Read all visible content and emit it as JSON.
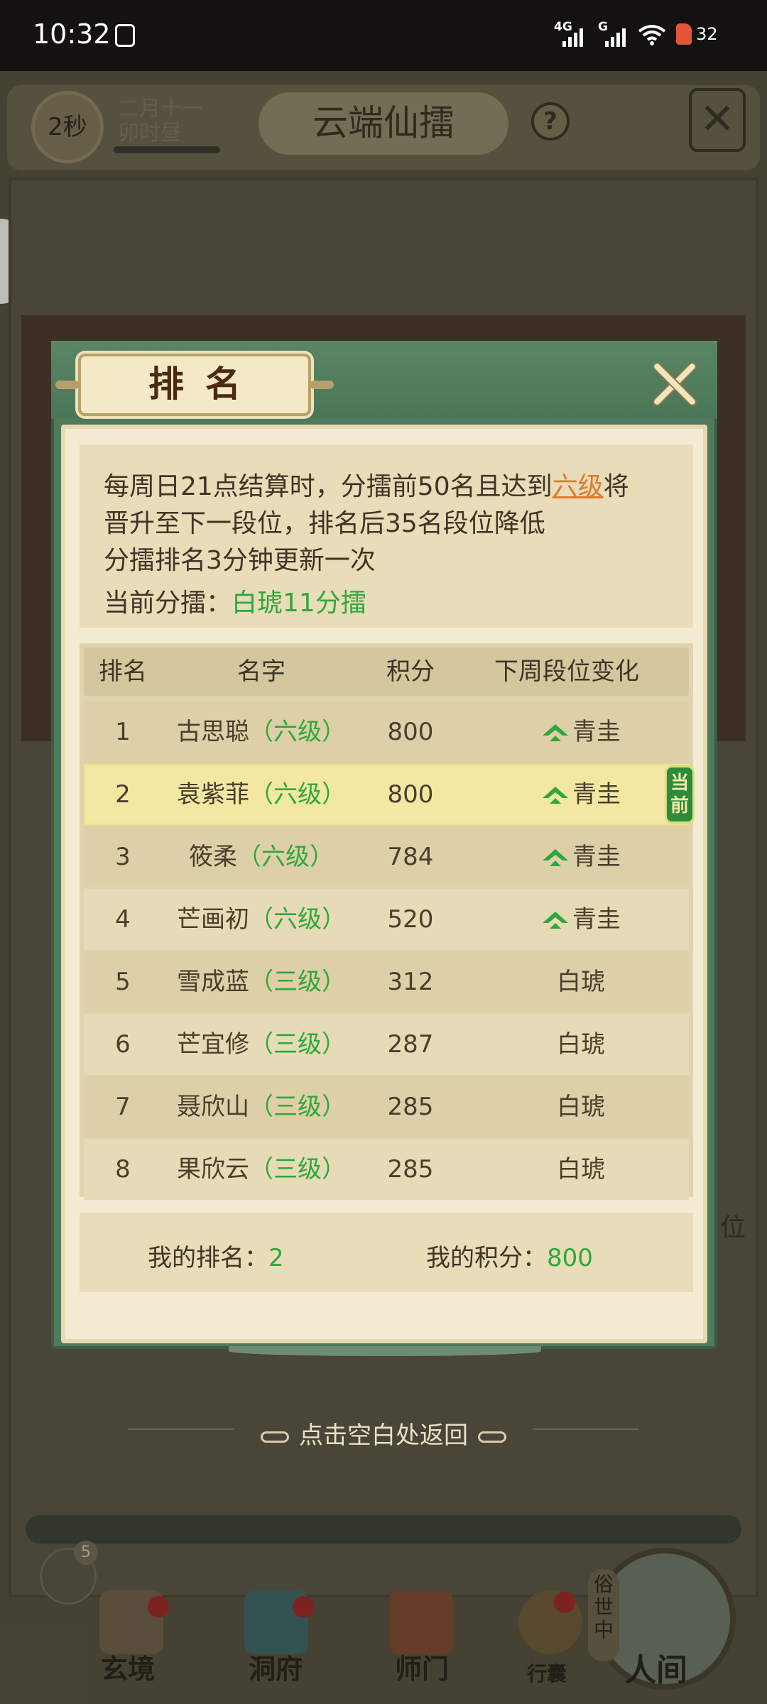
{
  "status_bar": {
    "time": "10:32",
    "net1": "4G",
    "net2": "G",
    "battery": "32"
  },
  "game": {
    "timer": "2秒",
    "date_line1": "二月十一",
    "date_line2": "卯时昼",
    "title": "云端仙擂",
    "help": "?",
    "side_text": "位",
    "chat_badge": "5",
    "nav": [
      "玄境",
      "洞府",
      "师门",
      "行囊",
      "人间"
    ],
    "world_label": "俗世中"
  },
  "modal": {
    "title": "排名",
    "rules": {
      "line1_pre": "每周日21点结算时，分擂前50名且达到",
      "line1_hl": "六级",
      "line1_post": "将",
      "line2": "晋升至下一段位，排名后35名段位降低",
      "line3": "分擂排名3分钟更新一次",
      "current_label": "当前分擂：",
      "current_value": "白琥11分擂"
    },
    "headers": {
      "rank": "排名",
      "name": "名字",
      "score": "积分",
      "change": "下周段位变化"
    },
    "rows": [
      {
        "rank": "1",
        "name": "古思聪",
        "level": "（六级）",
        "score": "800",
        "change": "青圭",
        "up": true
      },
      {
        "rank": "2",
        "name": "袁紫菲",
        "level": "（六级）",
        "score": "800",
        "change": "青圭",
        "up": true,
        "current": true
      },
      {
        "rank": "3",
        "name": "筱柔",
        "level": "（六级）",
        "score": "784",
        "change": "青圭",
        "up": true
      },
      {
        "rank": "4",
        "name": "芒画初",
        "level": "（六级）",
        "score": "520",
        "change": "青圭",
        "up": true
      },
      {
        "rank": "5",
        "name": "雪成蓝",
        "level": "（三级）",
        "score": "312",
        "change": "白琥",
        "up": false
      },
      {
        "rank": "6",
        "name": "芒宜修",
        "level": "（三级）",
        "score": "287",
        "change": "白琥",
        "up": false
      },
      {
        "rank": "7",
        "name": "聂欣山",
        "level": "（三级）",
        "score": "285",
        "change": "白琥",
        "up": false
      },
      {
        "rank": "8",
        "name": "果欣云",
        "level": "（三级）",
        "score": "285",
        "change": "白琥",
        "up": false
      }
    ],
    "current_tag": "当前",
    "my_rank_label": "我的排名：",
    "my_rank": "2",
    "my_score_label": "我的积分：",
    "my_score": "800"
  },
  "back_hint": "点击空白处返回",
  "colors": {
    "accent_green": "#2fa83b",
    "highlight_orange": "#e07a2a",
    "frame_green": "#4f7a5b"
  }
}
